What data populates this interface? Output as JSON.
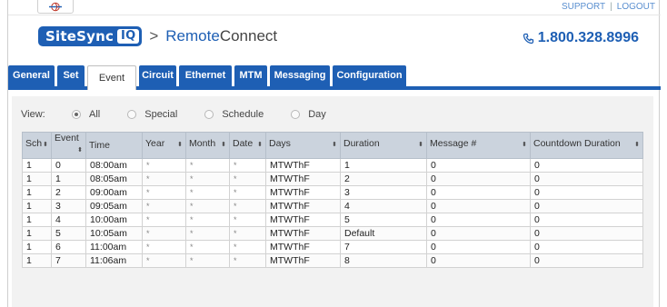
{
  "top_links": {
    "support": "SUPPORT",
    "separator": "|",
    "logout": "LOGOUT"
  },
  "brand": {
    "logo_text": "SiteSync",
    "logo_badge": "IQ",
    "separator": ">",
    "app_name_prefix": "Remote",
    "app_name_suffix": "Connect"
  },
  "phone": {
    "icon": "phone-icon",
    "number": "1.800.328.8996"
  },
  "tabs": [
    {
      "label": "General",
      "active": false
    },
    {
      "label": "Set",
      "active": false
    },
    {
      "label": "Event",
      "active": true
    },
    {
      "label": "Circuit",
      "active": false
    },
    {
      "label": "Ethernet",
      "active": false
    },
    {
      "label": "MTM",
      "active": false
    },
    {
      "label": "Messaging",
      "active": false
    },
    {
      "label": "Configuration",
      "active": false
    }
  ],
  "view_filter": {
    "label": "View:",
    "options": [
      {
        "label": "All",
        "checked": true
      },
      {
        "label": "Special",
        "checked": false
      },
      {
        "label": "Schedule",
        "checked": false
      },
      {
        "label": "Day",
        "checked": false
      }
    ]
  },
  "table": {
    "columns": [
      "Sch",
      "Event",
      "Time",
      "Year",
      "Month",
      "Date",
      "Days",
      "Duration",
      "Message #",
      "Countdown Duration"
    ],
    "sortable": [
      true,
      true,
      false,
      true,
      true,
      true,
      true,
      true,
      true,
      true
    ],
    "rows": [
      [
        "1",
        "0",
        "08:00am",
        "*",
        "*",
        "*",
        "MTWThF",
        "1",
        "0",
        "0"
      ],
      [
        "1",
        "1",
        "08:05am",
        "*",
        "*",
        "*",
        "MTWThF",
        "2",
        "0",
        "0"
      ],
      [
        "1",
        "2",
        "09:00am",
        "*",
        "*",
        "*",
        "MTWThF",
        "3",
        "0",
        "0"
      ],
      [
        "1",
        "3",
        "09:05am",
        "*",
        "*",
        "*",
        "MTWThF",
        "4",
        "0",
        "0"
      ],
      [
        "1",
        "4",
        "10:00am",
        "*",
        "*",
        "*",
        "MTWThF",
        "5",
        "0",
        "0"
      ],
      [
        "1",
        "5",
        "10:05am",
        "*",
        "*",
        "*",
        "MTWThF",
        "Default",
        "0",
        "0"
      ],
      [
        "1",
        "6",
        "11:00am",
        "*",
        "*",
        "*",
        "MTWThF",
        "7",
        "0",
        "0"
      ],
      [
        "1",
        "7",
        "11:06am",
        "*",
        "*",
        "*",
        "MTWThF",
        "8",
        "0",
        "0"
      ]
    ]
  },
  "colors": {
    "brand_blue": "#1e5fb4",
    "table_header": "#cbd3dd",
    "content_bg": "#f2f2f2",
    "link": "#5a8fd0"
  }
}
